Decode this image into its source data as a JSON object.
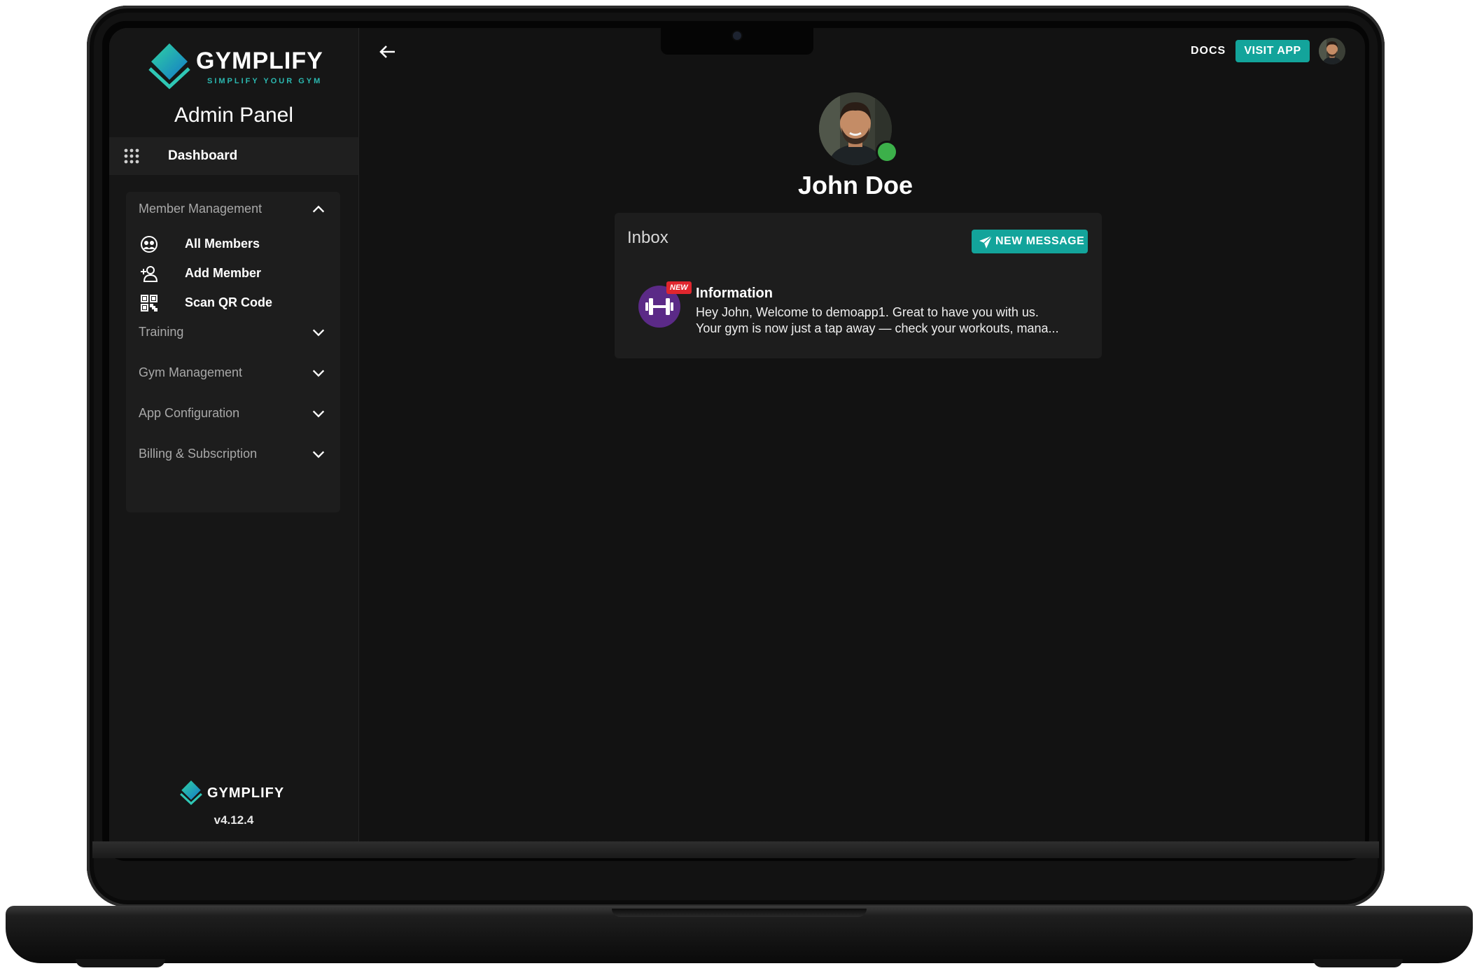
{
  "brand": {
    "name": "GYMPLIFY",
    "tagline": "SIMPLIFY YOUR GYM"
  },
  "sidebar": {
    "panel_title": "Admin Panel",
    "dashboard_label": "Dashboard",
    "groups": [
      {
        "label": "Member Management",
        "expanded": true,
        "items": [
          {
            "label": "All Members",
            "icon": "members-icon"
          },
          {
            "label": "Add Member",
            "icon": "add-person-icon"
          },
          {
            "label": "Scan QR Code",
            "icon": "qr-code-icon"
          }
        ]
      },
      {
        "label": "Training",
        "expanded": false
      },
      {
        "label": "Gym Management",
        "expanded": false
      },
      {
        "label": "App Configuration",
        "expanded": false
      },
      {
        "label": "Billing & Subscription",
        "expanded": false
      }
    ],
    "footer": {
      "brand": "GYMPLIFY",
      "version": "v4.12.4"
    }
  },
  "topbar": {
    "docs_label": "DOCS",
    "visit_app_label": "VISIT APP"
  },
  "profile": {
    "name": "John Doe",
    "status": "online"
  },
  "inbox": {
    "title": "Inbox",
    "new_message_label": "NEW MESSAGE",
    "messages": [
      {
        "badge": "NEW",
        "title": "Information",
        "line1": "Hey John, Welcome to demoapp1. Great to have you with us.",
        "line2": "Your gym is now just a tap away — check your workouts, mana..."
      }
    ]
  },
  "colors": {
    "accent": "#13a49b",
    "online": "#3cb04a",
    "badge": "#e0262e",
    "screen_bg": "#121212"
  }
}
